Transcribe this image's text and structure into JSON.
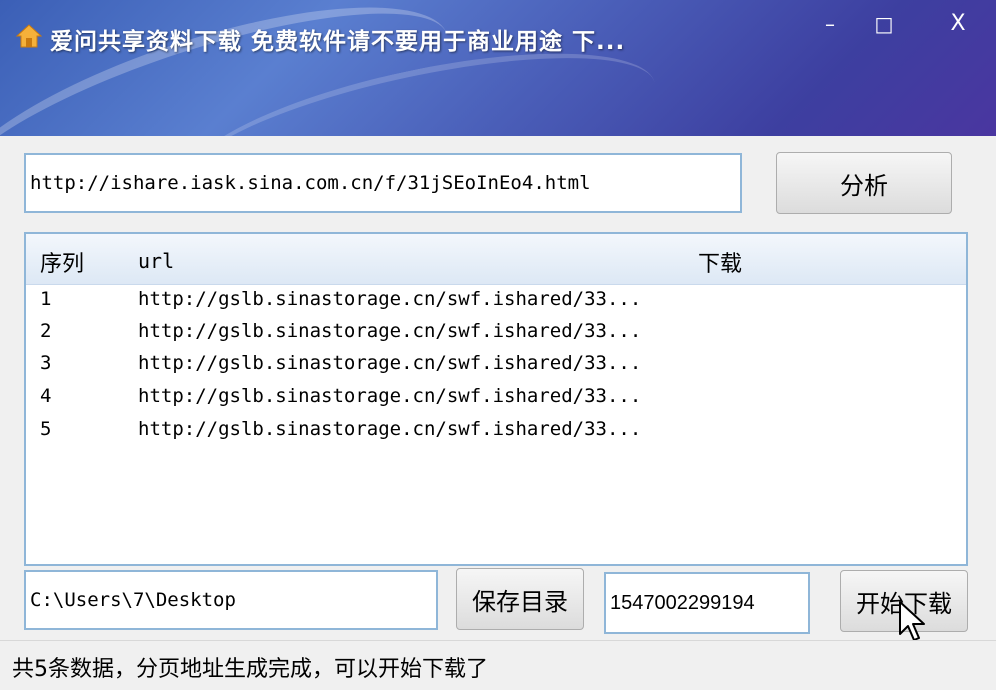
{
  "window": {
    "title": "爱问共享资料下载 免费软件请不要用于商业用途 下...",
    "minimize_glyph": "–",
    "maximize_glyph": "□",
    "close_glyph": "X",
    "icon": "home-icon"
  },
  "url_field": {
    "value": "http://ishare.iask.sina.com.cn/f/31jSEoInEo4.html"
  },
  "analyze_button": {
    "label": "分析"
  },
  "list": {
    "columns": [
      "序列",
      "url",
      "下载"
    ],
    "rows": [
      {
        "seq": "1",
        "url": "http://gslb.sinastorage.cn/swf.ishared/33...",
        "download": ""
      },
      {
        "seq": "2",
        "url": "http://gslb.sinastorage.cn/swf.ishared/33...",
        "download": ""
      },
      {
        "seq": "3",
        "url": "http://gslb.sinastorage.cn/swf.ishared/33...",
        "download": ""
      },
      {
        "seq": "4",
        "url": "http://gslb.sinastorage.cn/swf.ishared/33...",
        "download": ""
      },
      {
        "seq": "5",
        "url": "http://gslb.sinastorage.cn/swf.ishared/33...",
        "download": ""
      }
    ]
  },
  "save_dir_field": {
    "value": "C:\\Users\\7\\Desktop"
  },
  "save_dir_button": {
    "label": "保存目录"
  },
  "timestamp_field": {
    "value": "1547002299194"
  },
  "start_button": {
    "label": "开始下载"
  },
  "status": {
    "text": "共5条数据，分页地址生成完成，可以开始下载了"
  },
  "colors": {
    "title_gradient_start": "#3b5fb6",
    "title_gradient_end": "#4a36a0",
    "field_border": "#8fb6d8"
  }
}
